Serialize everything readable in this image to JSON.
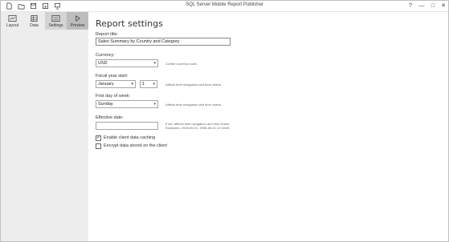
{
  "window": {
    "title": "SQL Server Mobile Report Publisher",
    "controls": [
      "?",
      "—",
      "□",
      "✕"
    ]
  },
  "nav": {
    "tabs": [
      {
        "label": "Layout",
        "icon": "layout-icon"
      },
      {
        "label": "Data",
        "icon": "data-icon"
      },
      {
        "label": "Settings",
        "icon": "settings-icon"
      },
      {
        "label": "Preview",
        "icon": "preview-icon"
      }
    ]
  },
  "page": {
    "title": "Report settings"
  },
  "form": {
    "report_title": {
      "label": "Report title:",
      "value": "Sales Summary by Country and Category"
    },
    "currency": {
      "label": "Currency:",
      "value": "USD",
      "hint": "3-letter currency code."
    },
    "fiscal_year": {
      "label": "Fiscal year start:",
      "month": "January",
      "day": "1",
      "hint": "Affects time navigators and time charts."
    },
    "first_day": {
      "label": "First day of week:",
      "value": "Sunday",
      "hint": "Affects time navigators and time charts."
    },
    "effective_date": {
      "label": "Effective date:",
      "value": "",
      "hint_line1": "If set, affects time navigators and time charts.",
      "hint_line2": "Examples: 2008-06-01, 2008-06-01 12:34:56."
    },
    "caching": {
      "label": "Enable client data caching",
      "checked": true,
      "mark": "✓"
    },
    "encrypt": {
      "label": "Encrypt data stored on the client",
      "checked": false,
      "mark": ""
    }
  }
}
